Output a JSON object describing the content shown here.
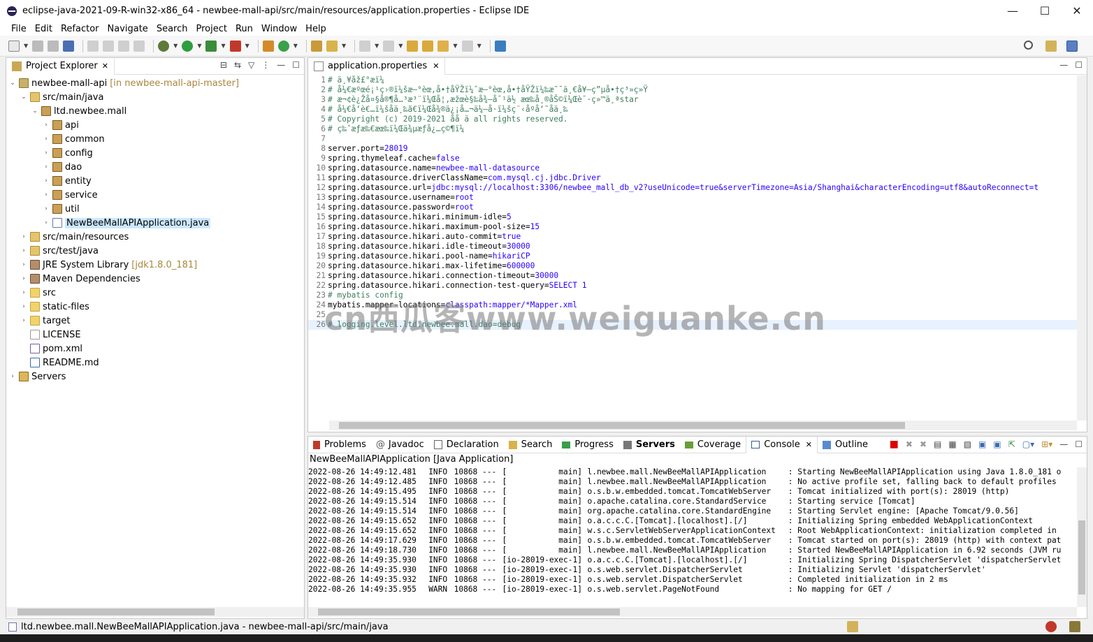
{
  "window": {
    "title": "eclipse-java-2021-09-R-win32-x86_64 - newbee-mall-api/src/main/resources/application.properties - Eclipse IDE",
    "controls": {
      "minimize": "—",
      "maximize": "☐",
      "close": "✕"
    }
  },
  "menu": [
    "File",
    "Edit",
    "Refactor",
    "Navigate",
    "Search",
    "Project",
    "Run",
    "Window",
    "Help"
  ],
  "explorer": {
    "title": "Project Explorer",
    "items": [
      {
        "label": "newbee-mall-api",
        "extra": "[in newbee-mall-api-master]",
        "icon": "project-icon"
      },
      {
        "label": "src/main/java",
        "icon": "source-folder-icon"
      },
      {
        "label": "ltd.newbee.mall",
        "icon": "package-icon"
      },
      {
        "label": "api",
        "icon": "package-icon"
      },
      {
        "label": "common",
        "icon": "package-icon"
      },
      {
        "label": "config",
        "icon": "package-icon"
      },
      {
        "label": "dao",
        "icon": "package-icon"
      },
      {
        "label": "entity",
        "icon": "package-icon"
      },
      {
        "label": "service",
        "icon": "package-icon"
      },
      {
        "label": "util",
        "icon": "package-icon"
      },
      {
        "label": "NewBeeMallAPIApplication.java",
        "icon": "java-file-icon"
      },
      {
        "label": "src/main/resources",
        "icon": "source-folder-icon"
      },
      {
        "label": "src/test/java",
        "icon": "source-folder-icon"
      },
      {
        "label": "JRE System Library",
        "extra": "[jdk1.8.0_181]",
        "icon": "library-icon"
      },
      {
        "label": "Maven Dependencies",
        "icon": "library-icon"
      },
      {
        "label": "src",
        "icon": "folder-icon"
      },
      {
        "label": "static-files",
        "icon": "folder-icon"
      },
      {
        "label": "target",
        "icon": "folder-icon"
      },
      {
        "label": "LICENSE",
        "icon": "file-icon"
      },
      {
        "label": "pom.xml",
        "icon": "xml-file-icon"
      },
      {
        "label": "README.md",
        "icon": "markdown-file-icon"
      },
      {
        "label": "Servers",
        "icon": "servers-folder-icon"
      }
    ]
  },
  "editor": {
    "tab": "application.properties",
    "lines": [
      {
        "n": "1",
        "text": "# ä¸¥åž£°æï¼"
      },
      {
        "n": "2",
        "text": "# å¼€æºœé¡¹ç›®ï¼šæ–°èœ‚å•†åŸŽï¼ˆæ–°èœ‚å•†åŸŽï¼‰æ˜¯ä¸€å¥—ç”µå•†ç³»ç»Ÿ"
      },
      {
        "n": "3",
        "text": "# æ¬¢è¿Žå¤§å®¶å…³æ³¨ï¼Œå¦‚æžœè§‰å¾—å¯¹ä½ æœ‰å¸®åŠ©ï¼Œè¯·ç»™ä¸ªstar"
      },
      {
        "n": "4",
        "text": "# å¼€å‘è€…ï¼šåä¸‰ã€ï¼Œå¾®ä¿¡å…¬ä¼—å·ï¼šç¨‹åºå‘˜åä¸‰"
      },
      {
        "n": "5",
        "text": "# Copyright (c) 2019-2021 åå ä all rights reserved."
      },
      {
        "n": "6",
        "text": "# ç‰ˆæƒæ‰€æœ‰ï¼Œä¾µæƒå¿…ç©¶ï¼"
      },
      {
        "n": "7",
        "text": ""
      },
      {
        "n": "8",
        "key": "server.port",
        "val": "28019"
      },
      {
        "n": "9",
        "key": "spring.thymeleaf.cache",
        "val": "false"
      },
      {
        "n": "10",
        "key": "spring.datasource.name",
        "val": "newbee-mall-datasource"
      },
      {
        "n": "11",
        "key": "spring.datasource.driverClassName",
        "val": "com.mysql.cj.jdbc.Driver"
      },
      {
        "n": "12",
        "key": "spring.datasource.url",
        "val": "jdbc:mysql://localhost:3306/newbee_mall_db_v2?useUnicode=true&serverTimezone=Asia/Shanghai&characterEncoding=utf8&autoReconnect=t"
      },
      {
        "n": "13",
        "key": "spring.datasource.username",
        "val": "root"
      },
      {
        "n": "14",
        "key": "spring.datasource.password",
        "val": "root"
      },
      {
        "n": "15",
        "key": "spring.datasource.hikari.minimum-idle",
        "val": "5"
      },
      {
        "n": "16",
        "key": "spring.datasource.hikari.maximum-pool-size",
        "val": "15"
      },
      {
        "n": "17",
        "key": "spring.datasource.hikari.auto-commit",
        "val": "true"
      },
      {
        "n": "18",
        "key": "spring.datasource.hikari.idle-timeout",
        "val": "30000"
      },
      {
        "n": "19",
        "key": "spring.datasource.hikari.pool-name",
        "val": "hikariCP"
      },
      {
        "n": "20",
        "key": "spring.datasource.hikari.max-lifetime",
        "val": "600000"
      },
      {
        "n": "21",
        "key": "spring.datasource.hikari.connection-timeout",
        "val": "30000"
      },
      {
        "n": "22",
        "key": "spring.datasource.hikari.connection-test-query",
        "val": "SELECT 1"
      },
      {
        "n": "23",
        "text": "# mybatis config"
      },
      {
        "n": "24",
        "key": "mybatis.mapper-locations",
        "val": "classpath:mapper/*Mapper.xml"
      },
      {
        "n": "25",
        "text": ""
      },
      {
        "n": "26",
        "text": "# logging.level.ltd.newbee.mall.dao=debug"
      }
    ]
  },
  "bottom": {
    "tabs": [
      "Problems",
      "Javadoc",
      "Declaration",
      "Search",
      "Progress",
      "Servers",
      "Coverage",
      "Console",
      "Outline"
    ],
    "console_title": "NewBeeMallAPIApplication [Java Application]",
    "log": [
      {
        "ts": "2022-08-26 14:49:12.481",
        "lvl": "INFO",
        "pid": "10868 ---",
        "thread": "[           main]",
        "logger": "l.newbee.mall.NewBeeMallAPIApplication",
        "msg": ": Starting NewBeeMallAPIApplication using Java 1.8.0_181 o"
      },
      {
        "ts": "2022-08-26 14:49:12.485",
        "lvl": "INFO",
        "pid": "10868 ---",
        "thread": "[           main]",
        "logger": "l.newbee.mall.NewBeeMallAPIApplication",
        "msg": ": No active profile set, falling back to default profiles"
      },
      {
        "ts": "2022-08-26 14:49:15.495",
        "lvl": "INFO",
        "pid": "10868 ---",
        "thread": "[           main]",
        "logger": "o.s.b.w.embedded.tomcat.TomcatWebServer",
        "msg": ": Tomcat initialized with port(s): 28019 (http)"
      },
      {
        "ts": "2022-08-26 14:49:15.514",
        "lvl": "INFO",
        "pid": "10868 ---",
        "thread": "[           main]",
        "logger": "o.apache.catalina.core.StandardService",
        "msg": ": Starting service [Tomcat]"
      },
      {
        "ts": "2022-08-26 14:49:15.514",
        "lvl": "INFO",
        "pid": "10868 ---",
        "thread": "[           main]",
        "logger": "org.apache.catalina.core.StandardEngine",
        "msg": ": Starting Servlet engine: [Apache Tomcat/9.0.56]"
      },
      {
        "ts": "2022-08-26 14:49:15.652",
        "lvl": "INFO",
        "pid": "10868 ---",
        "thread": "[           main]",
        "logger": "o.a.c.c.C.[Tomcat].[localhost].[/]",
        "msg": ": Initializing Spring embedded WebApplicationContext"
      },
      {
        "ts": "2022-08-26 14:49:15.652",
        "lvl": "INFO",
        "pid": "10868 ---",
        "thread": "[           main]",
        "logger": "w.s.c.ServletWebServerApplicationContext",
        "msg": ": Root WebApplicationContext: initialization completed in"
      },
      {
        "ts": "2022-08-26 14:49:17.629",
        "lvl": "INFO",
        "pid": "10868 ---",
        "thread": "[           main]",
        "logger": "o.s.b.w.embedded.tomcat.TomcatWebServer",
        "msg": ": Tomcat started on port(s): 28019 (http) with context pat"
      },
      {
        "ts": "2022-08-26 14:49:18.730",
        "lvl": "INFO",
        "pid": "10868 ---",
        "thread": "[           main]",
        "logger": "l.newbee.mall.NewBeeMallAPIApplication",
        "msg": ": Started NewBeeMallAPIApplication in 6.92 seconds (JVM ru"
      },
      {
        "ts": "2022-08-26 14:49:35.930",
        "lvl": "INFO",
        "pid": "10868 ---",
        "thread": "[io-28019-exec-1]",
        "logger": "o.a.c.c.C.[Tomcat].[localhost].[/]",
        "msg": ": Initializing Spring DispatcherServlet 'dispatcherServlet"
      },
      {
        "ts": "2022-08-26 14:49:35.930",
        "lvl": "INFO",
        "pid": "10868 ---",
        "thread": "[io-28019-exec-1]",
        "logger": "o.s.web.servlet.DispatcherServlet",
        "msg": ": Initializing Servlet 'dispatcherServlet'"
      },
      {
        "ts": "2022-08-26 14:49:35.932",
        "lvl": "INFO",
        "pid": "10868 ---",
        "thread": "[io-28019-exec-1]",
        "logger": "o.s.web.servlet.DispatcherServlet",
        "msg": ": Completed initialization in 2 ms"
      },
      {
        "ts": "2022-08-26 14:49:35.955",
        "lvl": "WARN",
        "pid": "10868 ---",
        "thread": "[io-28019-exec-1]",
        "logger": "o.s.web.servlet.PageNotFound",
        "msg": ": No mapping for GET /"
      }
    ]
  },
  "status": {
    "text": "ltd.newbee.mall.NewBeeMallAPIApplication.java - newbee-mall-api/src/main/java"
  },
  "watermark": "cn西瓜客www.weiguanke.cn"
}
